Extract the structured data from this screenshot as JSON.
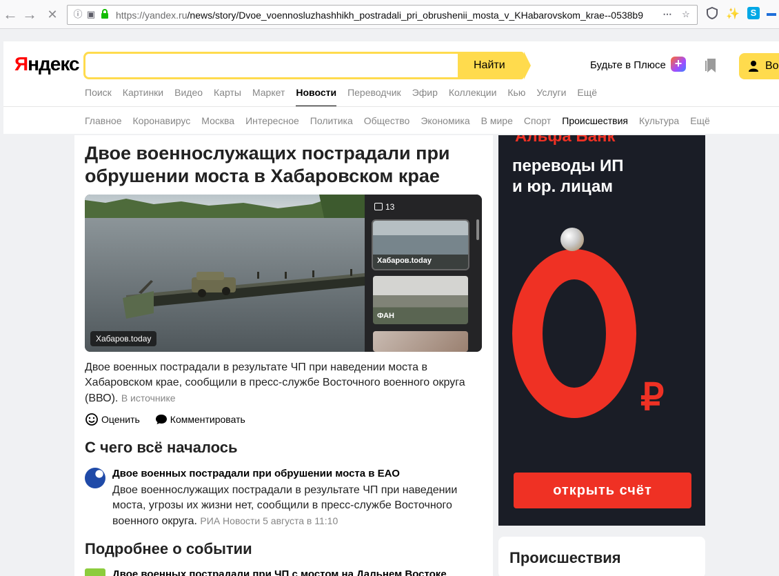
{
  "browser": {
    "url_host": "https://yandex.ru",
    "url_path": "/news/story/Dvoe_voennosluzhashhikh_postradali_pri_obrushenii_mosta_v_KHabarovskom_krae--0538b9"
  },
  "header": {
    "logo_first": "Я",
    "logo_rest": "ндекс",
    "search_value": "",
    "search_button": "Найти",
    "plus_label": "Будьте в Плюсе",
    "login_label": "Во"
  },
  "services": [
    "Поиск",
    "Картинки",
    "Видео",
    "Карты",
    "Маркет",
    "Новости",
    "Переводчик",
    "Эфир",
    "Коллекции",
    "Кью",
    "Услуги",
    "Ещё"
  ],
  "services_active": "Новости",
  "rubrics": [
    "Главное",
    "Коронавирус",
    "Москва",
    "Интересное",
    "Политика",
    "Общество",
    "Экономика",
    "В мире",
    "Спорт",
    "Происшествия",
    "Культура",
    "Ещё"
  ],
  "rubrics_active": "Происшествия",
  "article": {
    "title": "Двое военнослужащих пострадали при обрушении моста в Хабаровском крае",
    "photo_source": "Хабаров.today",
    "photo_count": "13",
    "thumbs": [
      {
        "label": "Хабаров.today"
      },
      {
        "label": "ФАН"
      },
      {
        "label": ""
      }
    ],
    "lead": "Двое военных пострадали в результате ЧП при наведении моста в Хабаровском крае, сообщили в пресс-службе Восточного военного округа (ВВО).",
    "lead_source": "В источнике",
    "rate_label": "Оценить",
    "comment_label": "Комментировать"
  },
  "sections": {
    "start_title": "С чего всё началось",
    "start_item": {
      "title": "Двое военных пострадали при обрушении моста в ЕАО",
      "text": "Двое военнослужащих пострадали в результате ЧП при наведении моста, угрозы их жизни нет, сообщили в пресс-службе Восточного военного округа.",
      "meta": "РИА Новости 5 августа в 11:10"
    },
    "more_title": "Подробнее о событии",
    "more_item": {
      "title": "Двое военных пострадали при ЧП с мостом на Дальнем Востоке"
    }
  },
  "ad": {
    "brand": "Альфа Банк",
    "line1": "переводы ИП",
    "line2": "и юр. лицам",
    "currency": "₽",
    "cta": "открыть счёт",
    "accent_color": "#ef3124"
  },
  "sidebar": {
    "title": "Происшествия"
  }
}
